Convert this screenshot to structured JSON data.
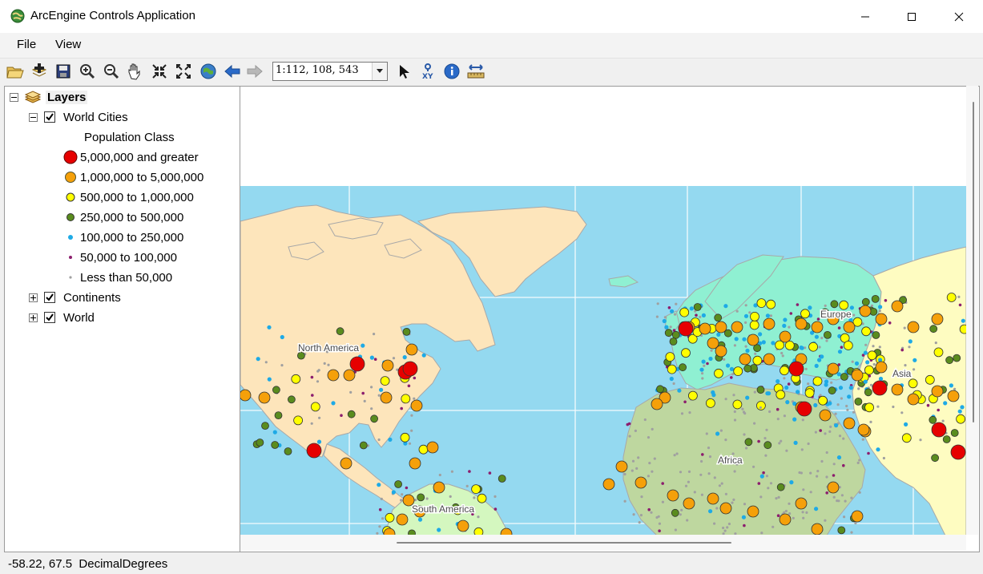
{
  "window": {
    "title": "ArcEngine Controls Application"
  },
  "menu": {
    "file": "File",
    "view": "View"
  },
  "toolbar": {
    "scale_value": "1:112, 108, 543",
    "icons": [
      "open-icon",
      "add-data-icon",
      "save-icon",
      "zoom-in-icon",
      "zoom-out-icon",
      "pan-icon",
      "fixed-zoom-in-icon",
      "fixed-zoom-out-icon",
      "full-extent-icon",
      "back-icon",
      "forward-icon",
      "select-icon",
      "go-to-xy-icon",
      "identify-icon",
      "measure-icon"
    ]
  },
  "toc": {
    "root_label": "Layers",
    "layers": [
      {
        "label": "World Cities",
        "checked": true,
        "expanded": true
      },
      {
        "label": "Continents",
        "checked": true,
        "expanded": false
      },
      {
        "label": "World",
        "checked": true,
        "expanded": false
      }
    ],
    "legend_heading": "Population Class",
    "legend": [
      {
        "label": "5,000,000 and greater",
        "color": "#e60000"
      },
      {
        "label": "1,000,000 to 5,000,000",
        "color": "#f5a00a"
      },
      {
        "label": "500,000 to 1,000,000",
        "color": "#ffff00"
      },
      {
        "label": "250,000 to 500,000",
        "color": "#5a8c1e"
      },
      {
        "label": "100,000 to 250,000",
        "color": "#1eaae6"
      },
      {
        "label": "50,000 to 100,000",
        "color": "#8c1e6e"
      },
      {
        "label": "Less than 50,000",
        "color": "#a0a0a0"
      }
    ]
  },
  "map": {
    "labels": {
      "north_america": "North America",
      "europe": "Europe",
      "asia": "Asia",
      "africa": "Africa",
      "south_america": "South America"
    },
    "colors": {
      "ocean": "#94d9f0",
      "north_america": "#fde5bb",
      "europe": "#8ff0d2",
      "asia": "#fefcc1",
      "africa": "#bed79f",
      "south_america": "#d4f7bf",
      "greenland": "#fde5bb"
    }
  },
  "status": {
    "coords": "-58.22, 67.5",
    "units": "DecimalDegrees"
  }
}
